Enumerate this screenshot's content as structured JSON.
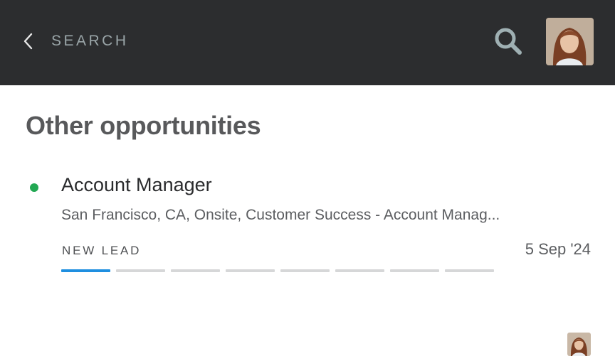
{
  "header": {
    "back_label": "SEARCH",
    "icons": [
      "chevron-left-icon",
      "search-icon"
    ],
    "background": "#2c2d2f"
  },
  "section": {
    "title": "Other opportunities"
  },
  "opportunity": {
    "title": "Account Manager",
    "meta": "San Francisco, CA, Onsite, Customer Success - Account Manag...",
    "stage": "NEW LEAD",
    "date": "5 Sep '24",
    "status_color": "#22a853",
    "progress": {
      "completed": 1,
      "total": 8
    },
    "progress_active_color": "#1f8fe0"
  }
}
